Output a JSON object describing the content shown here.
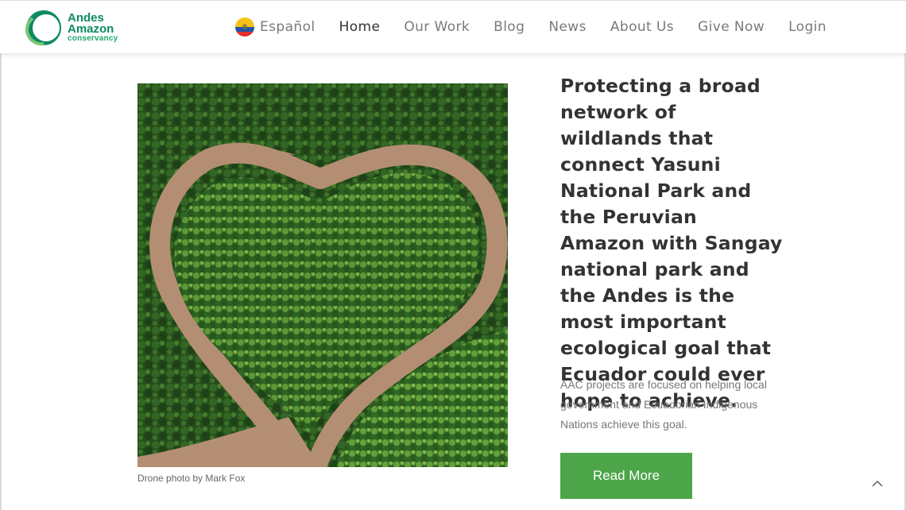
{
  "logo": {
    "line1": "Andes",
    "line2": "Amazon",
    "line3": "conservancy"
  },
  "nav": {
    "language": "Español",
    "items": [
      "Home",
      "Our Work",
      "Blog",
      "News",
      "About Us",
      "Give Now",
      "Login"
    ],
    "active": "Home"
  },
  "photo": {
    "caption": "Drone photo by Mark Fox"
  },
  "main": {
    "headline": "Protecting a broad network of wildlands that connect Yasuni National Park and the Peruvian Amazon with Sangay national park and the Andes is the most important ecological goal that Ecuador could ever hope to achieve.",
    "body": "AAC projects are focused on helping local government and Ecuadorian Indigenous Nations achieve this goal.",
    "button": "Read More"
  },
  "colors": {
    "brand": "#0e8a62",
    "button": "#4ca649"
  },
  "icons": {
    "to_top": "chevron-up-icon"
  }
}
